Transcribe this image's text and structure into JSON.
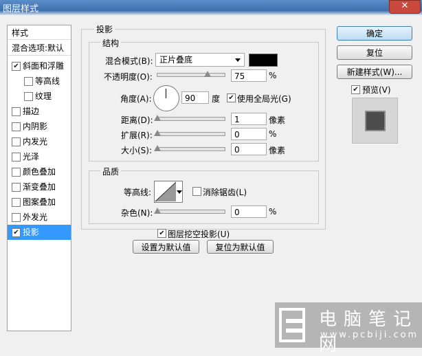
{
  "window": {
    "title": "图层样式",
    "close_glyph": "✕"
  },
  "left_panel": {
    "header": "样式",
    "blend_options": "混合选项:默认",
    "items": [
      {
        "label": "斜面和浮雕",
        "checked": true,
        "indent": false
      },
      {
        "label": "等高线",
        "checked": false,
        "indent": true
      },
      {
        "label": "纹理",
        "checked": false,
        "indent": true
      },
      {
        "label": "描边",
        "checked": false,
        "indent": false
      },
      {
        "label": "内阴影",
        "checked": false,
        "indent": false
      },
      {
        "label": "内发光",
        "checked": false,
        "indent": false
      },
      {
        "label": "光泽",
        "checked": false,
        "indent": false
      },
      {
        "label": "颜色叠加",
        "checked": false,
        "indent": false
      },
      {
        "label": "渐变叠加",
        "checked": false,
        "indent": false
      },
      {
        "label": "图案叠加",
        "checked": false,
        "indent": false
      },
      {
        "label": "外发光",
        "checked": false,
        "indent": false
      },
      {
        "label": "投影",
        "checked": true,
        "indent": false,
        "selected": true
      }
    ]
  },
  "main": {
    "section_title": "投影",
    "structure": {
      "title": "结构",
      "blend_mode_label": "混合模式(B):",
      "blend_mode_value": "正片叠底",
      "blend_color": "#000000",
      "opacity_label": "不透明度(O):",
      "opacity_value": "75",
      "opacity_unit": "%",
      "opacity_level": 0.75,
      "angle_label": "角度(A):",
      "angle_value": "90",
      "angle_unit": "度",
      "global_light_label": "使用全局光(G)",
      "global_light_checked": true,
      "distance_label": "距离(D):",
      "distance_value": "1",
      "distance_unit": "像素",
      "spread_label": "扩展(R):",
      "spread_value": "0",
      "spread_unit": "%",
      "size_label": "大小(S):",
      "size_value": "0",
      "size_unit": "像素"
    },
    "quality": {
      "title": "品质",
      "contour_label": "等高线:",
      "antialias_label": "消除锯齿(L)",
      "antialias_checked": false,
      "noise_label": "杂色(N):",
      "noise_value": "0",
      "noise_unit": "%"
    },
    "knockout_label": "图层挖空投影(U)",
    "knockout_checked": true,
    "set_default_button": "设置为默认值",
    "reset_default_button": "复位为默认值"
  },
  "right": {
    "ok_button": "确定",
    "reset_button": "复位",
    "new_style_button": "新建样式(W)...",
    "preview_label": "预览(V)",
    "preview_checked": true
  },
  "watermark": {
    "site_name": "电脑笔记网",
    "url": "www.pcbiji.com"
  }
}
